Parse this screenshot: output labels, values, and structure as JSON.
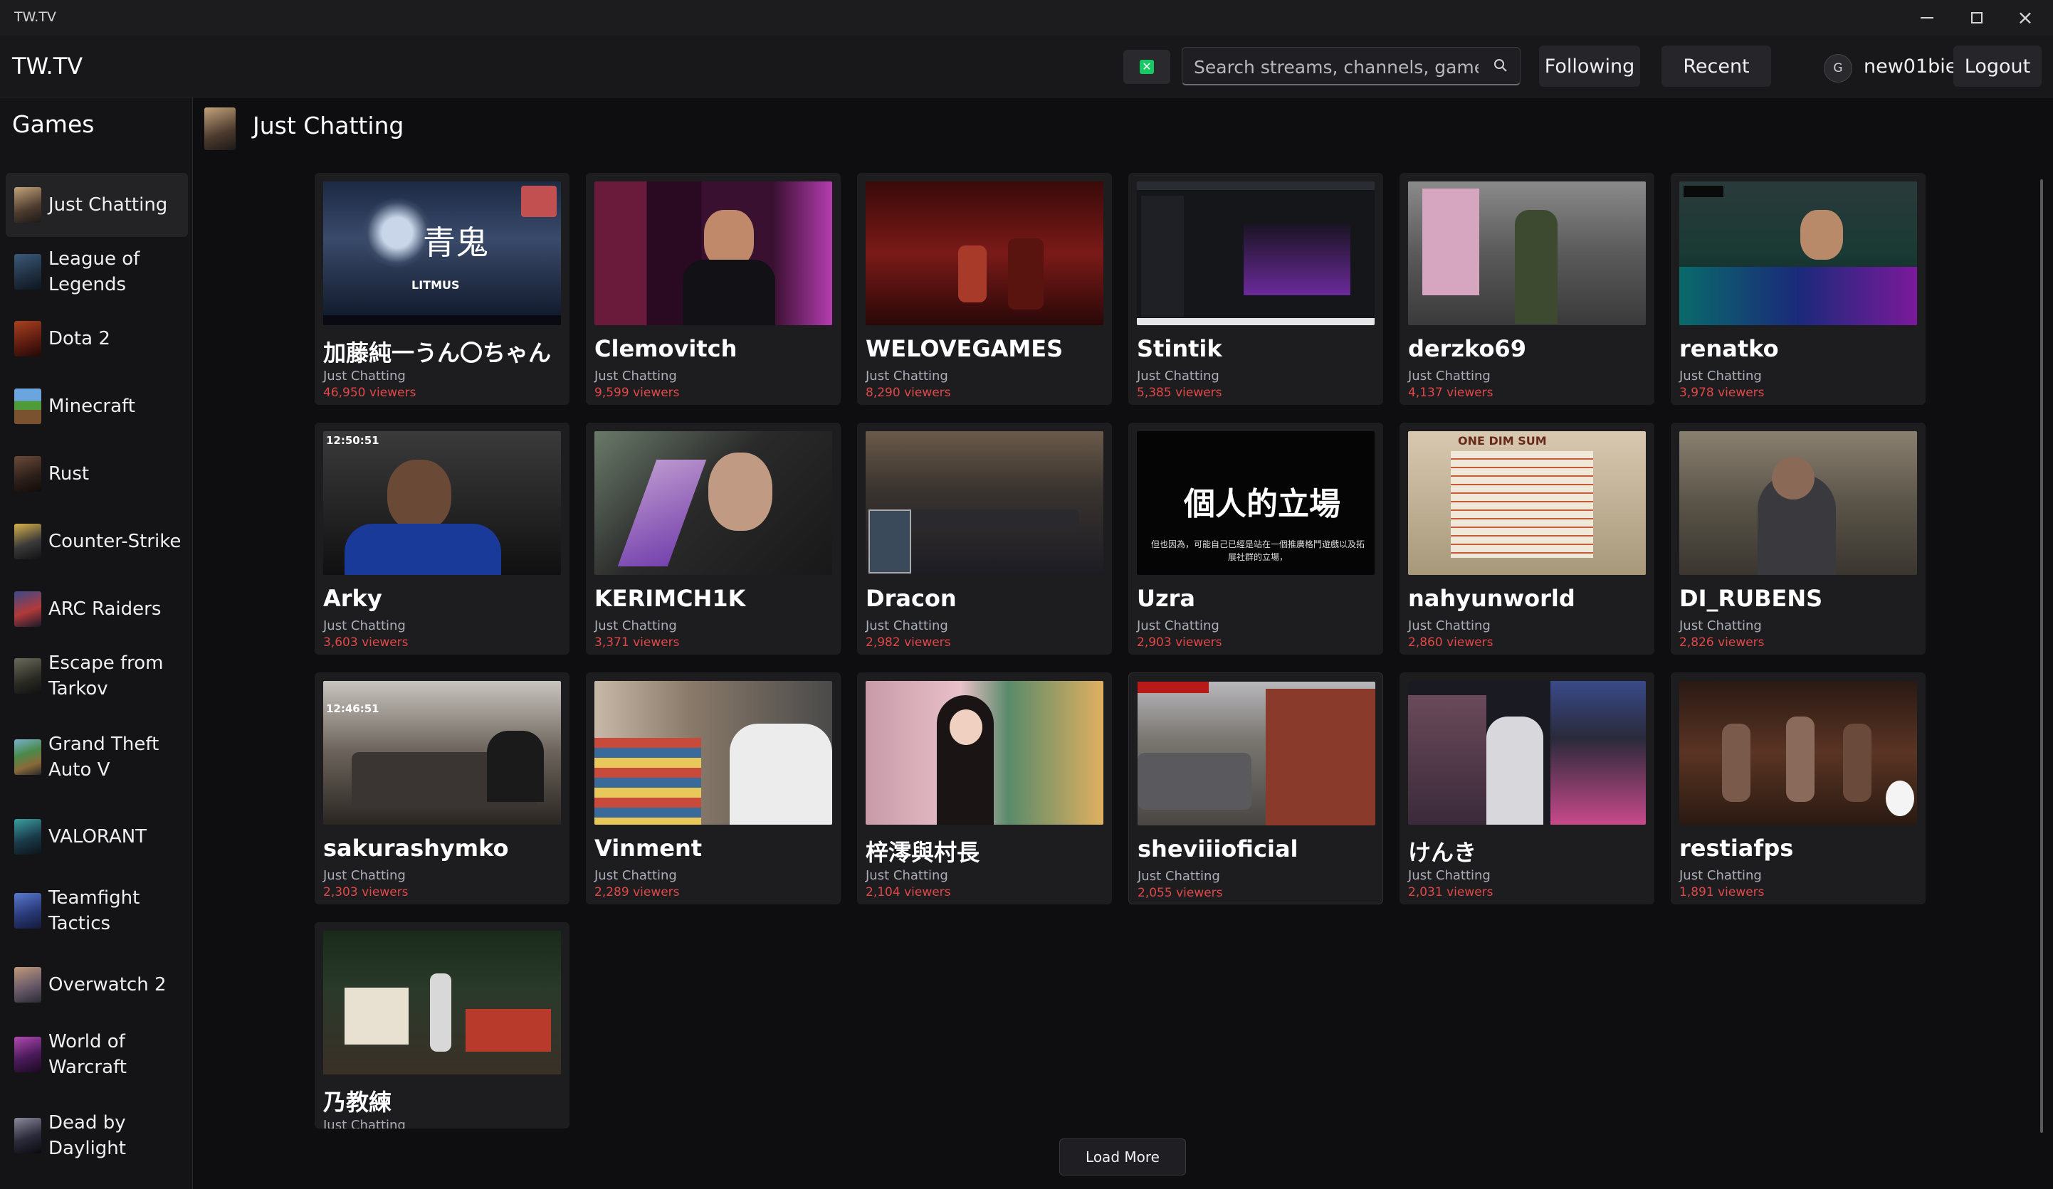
{
  "window": {
    "title": "TW.TV"
  },
  "header": {
    "brand": "TW.TV",
    "search_placeholder": "Search streams, channels, games...",
    "following_label": "Following",
    "recent_label": "Recent",
    "avatar_initial": "G",
    "username": "new01bie",
    "logout_label": "Logout"
  },
  "sidebar": {
    "title": "Games",
    "items": [
      {
        "label": "Just Chatting",
        "active": true
      },
      {
        "label": "League of Legends"
      },
      {
        "label": "Dota 2"
      },
      {
        "label": "Minecraft"
      },
      {
        "label": "Rust"
      },
      {
        "label": "Counter-Strike"
      },
      {
        "label": "ARC Raiders"
      },
      {
        "label": "Escape from Tarkov"
      },
      {
        "label": "Grand Theft Auto V"
      },
      {
        "label": "VALORANT"
      },
      {
        "label": "Teamfight Tactics"
      },
      {
        "label": "Overwatch 2"
      },
      {
        "label": "World of Warcraft"
      },
      {
        "label": "Dead by Daylight"
      }
    ]
  },
  "main": {
    "category_title": "Just Chatting",
    "streams": [
      {
        "name": "加藤純一うん〇ちゃん",
        "game": "Just Chatting",
        "viewers": "46,950 viewers"
      },
      {
        "name": "Clemovitch",
        "game": "Just Chatting",
        "viewers": "9,599 viewers"
      },
      {
        "name": "WELOVEGAMES",
        "game": "Just Chatting",
        "viewers": "8,290 viewers"
      },
      {
        "name": "Stintik",
        "game": "Just Chatting",
        "viewers": "5,385 viewers"
      },
      {
        "name": "derzko69",
        "game": "Just Chatting",
        "viewers": "4,137 viewers"
      },
      {
        "name": "renatko",
        "game": "Just Chatting",
        "viewers": "3,978 viewers"
      },
      {
        "name": "Arky",
        "game": "Just Chatting",
        "viewers": "3,603 viewers"
      },
      {
        "name": "KERIMCH1K",
        "game": "Just Chatting",
        "viewers": "3,371 viewers"
      },
      {
        "name": "Dracon",
        "game": "Just Chatting",
        "viewers": "2,982 viewers"
      },
      {
        "name": "Uzra",
        "game": "Just Chatting",
        "viewers": "2,903 viewers"
      },
      {
        "name": "nahyunworld",
        "game": "Just Chatting",
        "viewers": "2,860 viewers"
      },
      {
        "name": "DI_RUBENS",
        "game": "Just Chatting",
        "viewers": "2,826 viewers"
      },
      {
        "name": "sakurashymko",
        "game": "Just Chatting",
        "viewers": "2,303 viewers"
      },
      {
        "name": "Vinment",
        "game": "Just Chatting",
        "viewers": "2,289 viewers"
      },
      {
        "name": "梓澪與村長",
        "game": "Just Chatting",
        "viewers": "2,104 viewers"
      },
      {
        "name": "sheviiioficial",
        "game": "Just Chatting",
        "viewers": "2,055 viewers"
      },
      {
        "name": "けんき",
        "game": "Just Chatting",
        "viewers": "2,031 viewers"
      },
      {
        "name": "restiafps",
        "game": "Just Chatting",
        "viewers": "1,891 viewers"
      },
      {
        "name": "乃教練",
        "game": "Just Chatting",
        "viewers": ""
      }
    ],
    "thumb_overlays": {
      "s0_title": "青鬼",
      "s0_sub": "LITMUS",
      "s6_clock": "12:50:51",
      "s9_big": "個人的立場",
      "s9_small": "但也因為，可能自己已經是站在一個推廣格鬥遊戲以及拓展社群的立場，",
      "s10_sign": "ONE DIM SUM",
      "s12_clock": "12:46:51"
    },
    "load_more_label": "Load More"
  }
}
